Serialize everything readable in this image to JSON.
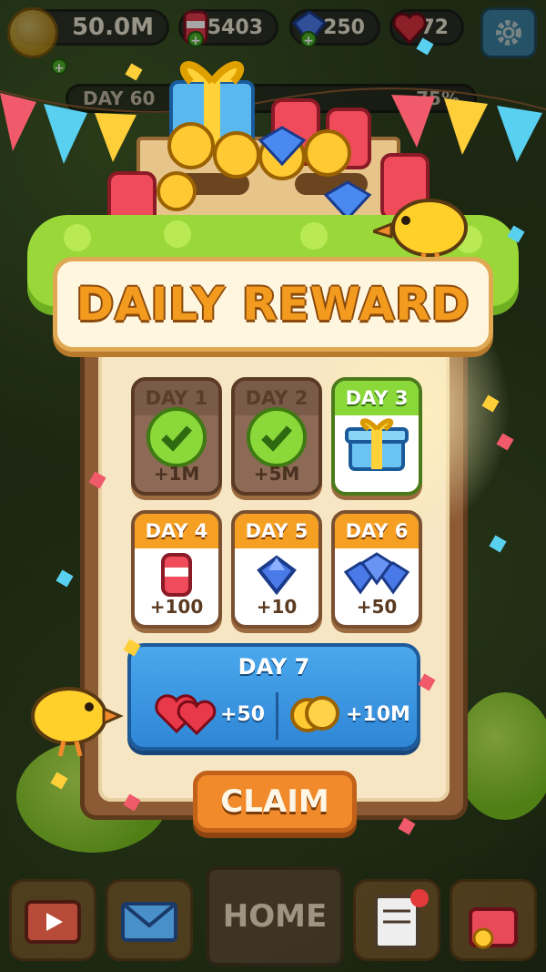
{
  "hud": {
    "coins": "50.0M",
    "soda": "5403",
    "gems": "250",
    "hearts": "72",
    "icons": [
      "coin-icon",
      "soda-can-icon",
      "gem-icon",
      "heart-icon",
      "settings-gear-icon"
    ]
  },
  "background": {
    "day_label": "DAY 60",
    "progress_percent": "75%"
  },
  "modal": {
    "title": "DAILY REWARD",
    "days": [
      {
        "label": "DAY 1",
        "amount": "+1M",
        "state": "claimed",
        "icon": "check-coin-icon"
      },
      {
        "label": "DAY 2",
        "amount": "+5M",
        "state": "claimed",
        "icon": "check-coin-icon"
      },
      {
        "label": "DAY 3",
        "amount": "",
        "state": "today",
        "icon": "gift-box-icon"
      },
      {
        "label": "DAY 4",
        "amount": "+100",
        "state": "future",
        "icon": "soda-can-icon"
      },
      {
        "label": "DAY 5",
        "amount": "+10",
        "state": "future",
        "icon": "gem-icon"
      },
      {
        "label": "DAY 6",
        "amount": "+50",
        "state": "future",
        "icon": "gem-pile-icon"
      }
    ],
    "day7": {
      "label": "DAY 7",
      "hearts_amount": "+50",
      "coins_amount": "+10M"
    },
    "claim_label": "CLAIM"
  },
  "bottom_nav": {
    "home_label": "HOME",
    "items": [
      "tv-ad-icon",
      "mail-icon",
      "home",
      "tasks-icon",
      "shop-icon"
    ]
  },
  "colors": {
    "title_orange": "#f39b1e",
    "today_green": "#8ad83a",
    "future_orange": "#f5a022",
    "day7_blue": "#2f86d6",
    "claim_orange": "#f08a2a"
  }
}
